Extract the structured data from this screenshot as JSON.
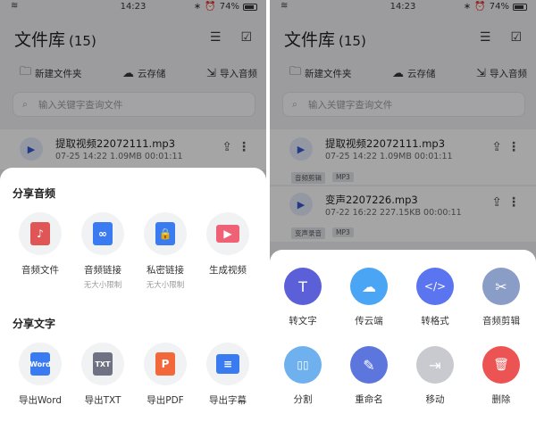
{
  "status": {
    "time": "14:23",
    "battery": "74%"
  },
  "library": {
    "title": "文件库",
    "count": "(15)"
  },
  "actions": {
    "new_folder": "新建文件夹",
    "cloud": "云存储",
    "import": "导入音频"
  },
  "search": {
    "placeholder": "输入关键字查询文件"
  },
  "files": [
    {
      "name": "提取视频22072111.mp3",
      "meta": "07-25 14:22   1.09MB   00:01:11",
      "tags": [
        "音频剪辑",
        "MP3"
      ]
    },
    {
      "name": "变声2207226.mp3",
      "meta": "07-22 16:22   227.15KB   00:00:11",
      "tags": [
        "变声录音",
        "MP3"
      ]
    }
  ],
  "share_sheet": {
    "audio_title": "分享音频",
    "audio_items": [
      {
        "label": "音频文件",
        "sub": "",
        "icon": "music-file-icon",
        "color": "#e05656"
      },
      {
        "label": "音频链接",
        "sub": "无大小限制",
        "icon": "link-icon",
        "color": "#3a7bf2"
      },
      {
        "label": "私密链接",
        "sub": "无大小限制",
        "icon": "private-link-icon",
        "color": "#3a7bf2"
      },
      {
        "label": "生成视频",
        "sub": "",
        "icon": "video-icon",
        "color": "#ef6276"
      }
    ],
    "text_title": "分享文字",
    "text_items": [
      {
        "label": "导出Word",
        "icon": "word-icon",
        "color": "#3a7bf2",
        "badge": "Word"
      },
      {
        "label": "导出TXT",
        "icon": "txt-icon",
        "color": "#6e7282",
        "badge": "TXT"
      },
      {
        "label": "导出PDF",
        "icon": "pdf-icon",
        "color": "#f2683a",
        "badge": "P"
      },
      {
        "label": "导出字幕",
        "icon": "subtitle-icon",
        "color": "#3a7bf2",
        "badge": ""
      }
    ]
  },
  "tools_sheet": {
    "items": [
      {
        "label": "转文字",
        "icon": "transcribe-icon",
        "color": "#5b60d8",
        "glyph": "T"
      },
      {
        "label": "传云端",
        "icon": "cloud-upload-icon",
        "color": "#4aa5f5",
        "glyph": "☁"
      },
      {
        "label": "转格式",
        "icon": "code-icon",
        "color": "#5b74ef",
        "glyph": "</>"
      },
      {
        "label": "音频剪辑",
        "icon": "scissors-icon",
        "color": "#8a9dc6",
        "glyph": "✂"
      },
      {
        "label": "分割",
        "icon": "split-icon",
        "color": "#6fb0ee",
        "glyph": "▯▯"
      },
      {
        "label": "重命名",
        "icon": "pencil-icon",
        "color": "#5d76de",
        "glyph": "✎"
      },
      {
        "label": "移动",
        "icon": "move-icon",
        "color": "#c8cad0",
        "glyph": "⇥"
      },
      {
        "label": "删除",
        "icon": "trash-icon",
        "color": "#ec5454",
        "glyph": "🗑"
      }
    ]
  }
}
